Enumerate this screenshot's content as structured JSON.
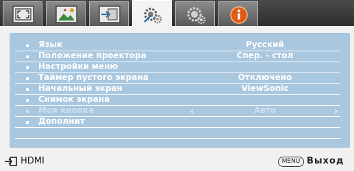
{
  "tabs": [
    {
      "icon": "display-icon"
    },
    {
      "icon": "picture-icon"
    },
    {
      "icon": "source-icon"
    },
    {
      "icon": "system-setup-icon",
      "active": true
    },
    {
      "icon": "advanced-setup-icon"
    },
    {
      "icon": "information-icon"
    }
  ],
  "menu": {
    "items": [
      {
        "label": "Язык",
        "value": "Русский"
      },
      {
        "label": "Положение проектора",
        "value": "Спер. - стол"
      },
      {
        "label": "Настройки меню",
        "value": ""
      },
      {
        "label": "Таймер пустого экрана",
        "value": "Отключено"
      },
      {
        "label": "Начальный экран",
        "value": "ViewSonic"
      },
      {
        "label": "Снимок экрана",
        "value": ""
      },
      {
        "label": "Моя кнопка",
        "value": "Авто",
        "disabled": true
      },
      {
        "label": "Дополнит",
        "value": ""
      }
    ]
  },
  "status": {
    "source": "HDMI",
    "menu_key": "MENU",
    "exit": "Выход"
  },
  "colors": {
    "panel": "#a9c7df",
    "frame": "#f1f1f1",
    "tabbar": "#3a3a3a",
    "text": "#ffffff"
  }
}
